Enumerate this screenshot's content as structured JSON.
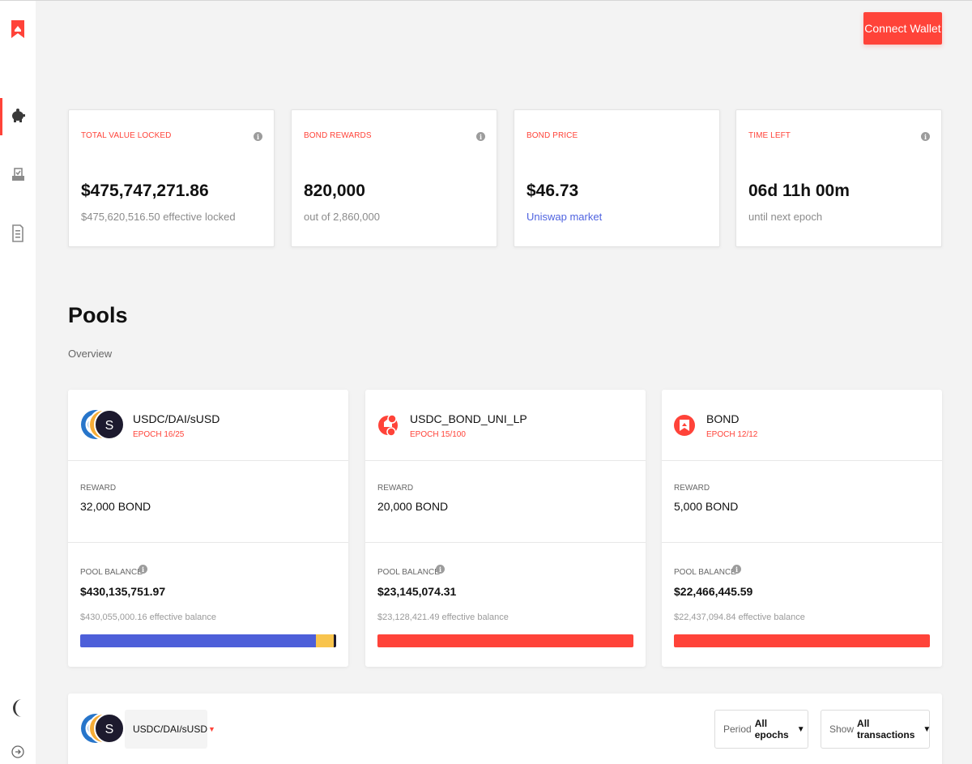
{
  "colors": {
    "accent": "#ff4339",
    "link": "#4f63e0",
    "usdc_bar": "#4d5fd9",
    "dai_bar": "#f8c44d",
    "susd_bar": "#1d1a2e"
  },
  "sidebar": {
    "icons": [
      "barnbridge-logo-icon",
      "piggy-bank-icon",
      "vote-box-icon",
      "document-icon",
      "moon-icon",
      "logout-icon"
    ]
  },
  "header": {
    "connect_label": "Connect Wallet"
  },
  "stats": [
    {
      "label": "TOTAL VALUE LOCKED",
      "value": "$475,747,271.86",
      "sub": "$475,620,516.50 effective locked"
    },
    {
      "label": "BOND REWARDS",
      "value": "820,000",
      "sub": "out of 2,860,000"
    },
    {
      "label": "BOND PRICE",
      "value": "$46.73",
      "sub": "Uniswap market"
    },
    {
      "label": "TIME LEFT",
      "value": "06d 11h 00m",
      "sub": "until next epoch"
    }
  ],
  "pools_section": {
    "title": "Pools",
    "subtitle": "Overview"
  },
  "pools": [
    {
      "name": "USDC/DAI/sUSD",
      "epoch": "EPOCH 16/25",
      "reward_label": "REWARD",
      "reward": "32,000 BOND",
      "balance_label": "POOL BALANCE",
      "balance": "$430,135,751.97",
      "effective": "$430,055,000.16 effective balance",
      "bar_fractions": [
        0.92,
        0.072,
        0.008
      ]
    },
    {
      "name": "USDC_BOND_UNI_LP",
      "epoch": "EPOCH 15/100",
      "reward_label": "REWARD",
      "reward": "20,000 BOND",
      "balance_label": "POOL BALANCE",
      "balance": "$23,145,074.31",
      "effective": "$23,128,421.49 effective balance",
      "bar_fractions": [
        1.0
      ]
    },
    {
      "name": "BOND",
      "epoch": "EPOCH 12/12",
      "reward_label": "REWARD",
      "reward": "5,000 BOND",
      "balance_label": "POOL BALANCE",
      "balance": "$22,466,445.59",
      "effective": "$22,437,094.84 effective balance",
      "bar_fractions": [
        1.0
      ]
    }
  ],
  "transactions": {
    "selected_pool": "USDC/DAI/sUSD",
    "period_label": "Period",
    "period_value": "All epochs",
    "show_label": "Show",
    "show_value": "All transactions"
  }
}
